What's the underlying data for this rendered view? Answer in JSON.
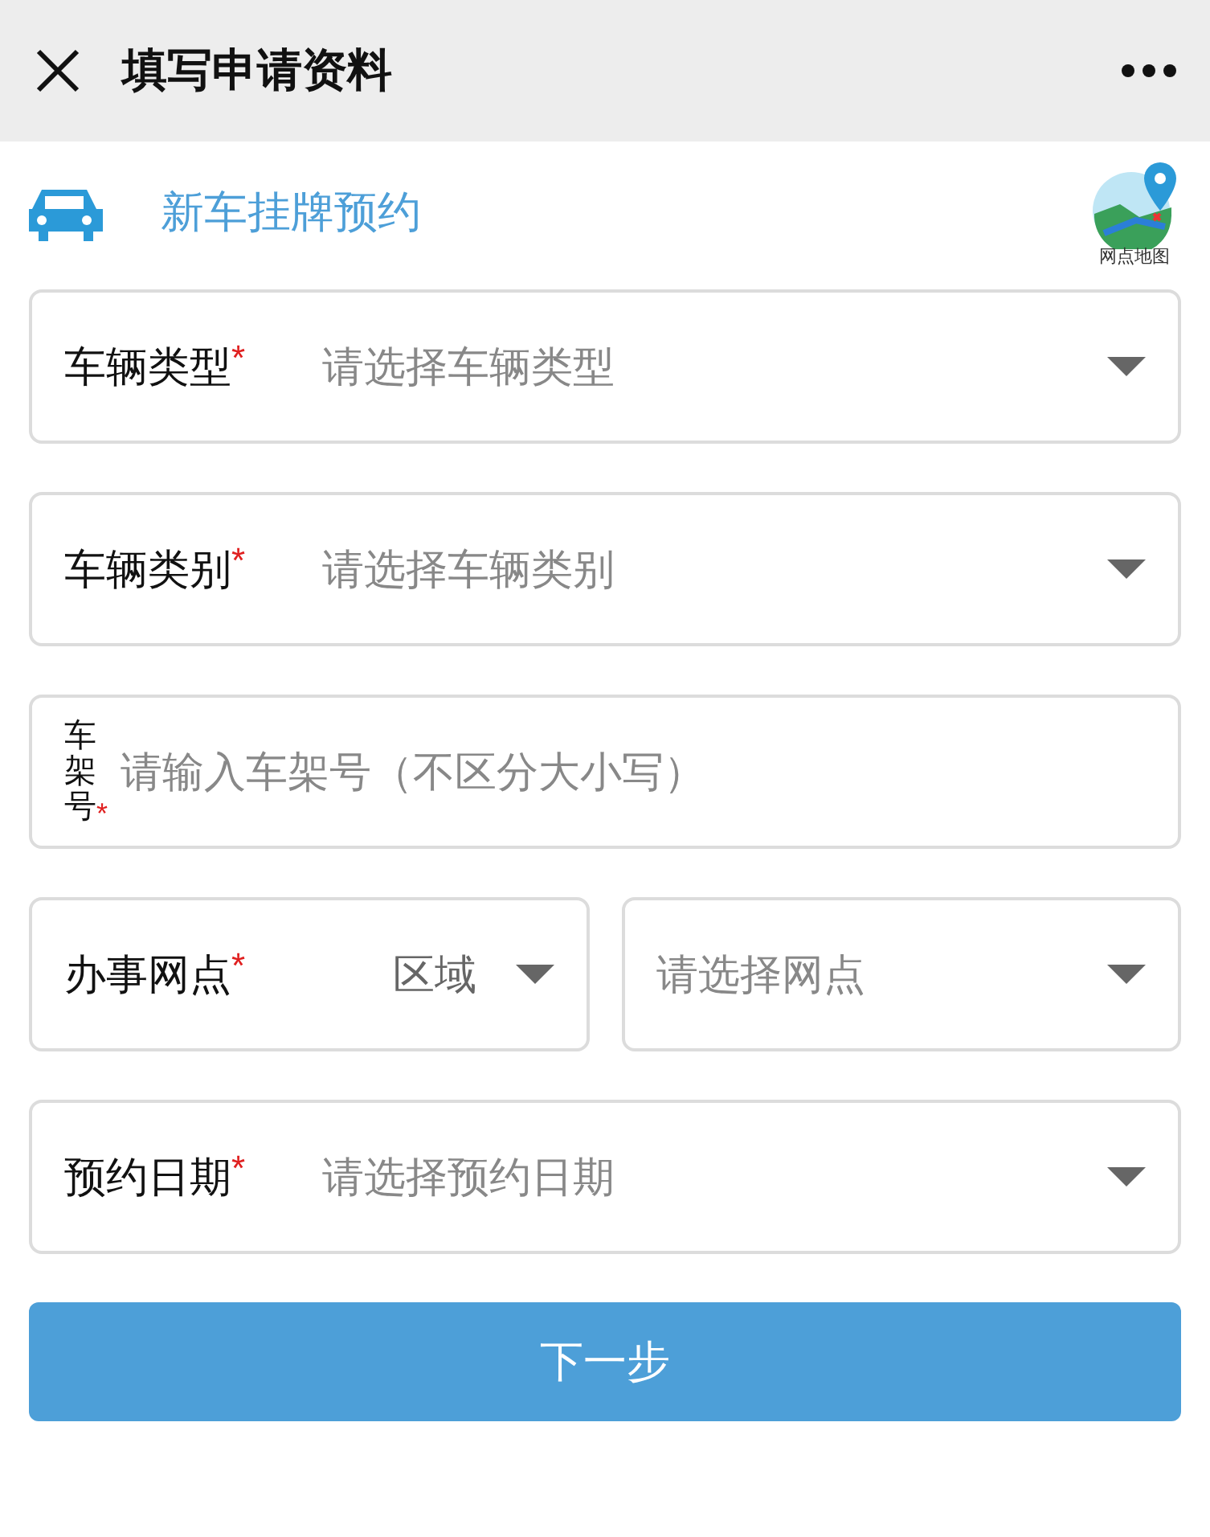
{
  "header": {
    "title": "填写申请资料"
  },
  "service": {
    "name": "新车挂牌预约",
    "map_link": "网点地图"
  },
  "fields": [
    {
      "kind": "select",
      "label": "车辆类型",
      "mark": "*",
      "placeholder": "请选择车辆类型"
    },
    {
      "kind": "select",
      "label": "车辆类别",
      "mark": "*",
      "placeholder": "请选择车辆类别"
    },
    {
      "kind": "input",
      "label": "车架号",
      "mark": "*",
      "placeholder": "请输入车架号（不区分大小写）"
    },
    {
      "kind": "pair",
      "label": "办事网点",
      "mark": "*",
      "left": "区域",
      "right": "请选择网点"
    },
    {
      "kind": "select",
      "label": "预约日期",
      "mark": "*",
      "placeholder": "请选择预约日期"
    }
  ],
  "next_button": "下一步"
}
